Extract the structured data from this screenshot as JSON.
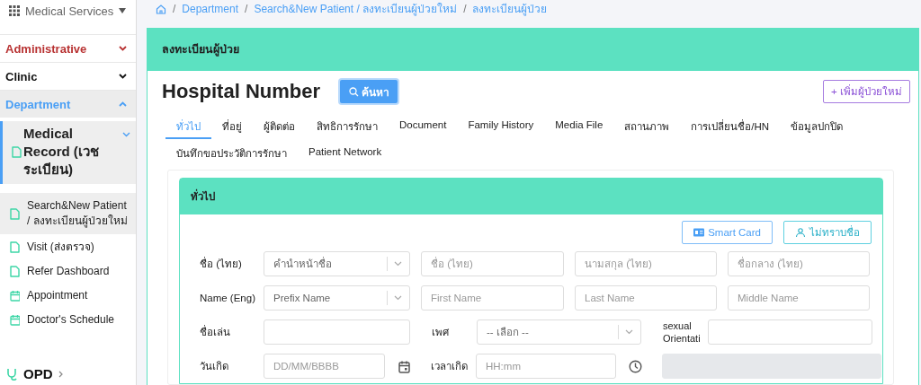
{
  "sidebar": {
    "header": "Medical Services",
    "sections": [
      {
        "kind": "group",
        "label": "Administrative",
        "color": "#b83232",
        "expanded": false
      },
      {
        "kind": "group",
        "label": "Clinic",
        "color": "#111111",
        "expanded": false
      },
      {
        "kind": "group",
        "label": "Department",
        "color": "#4a9ff5",
        "expanded": true,
        "children": [
          {
            "label": "Medical Record (เวชระเบียน)",
            "kind": "file",
            "expanded": true,
            "active": true,
            "children": [
              {
                "label": "Search&New Patient / ลงทะเบียนผู้ป่วยใหม่",
                "kind": "file",
                "selected": true
              },
              {
                "label": "Visit (ส่งตรวจ)",
                "kind": "file",
                "selected": false
              },
              {
                "label": "Refer Dashboard",
                "kind": "file",
                "selected": false
              },
              {
                "label": "Appointment",
                "kind": "calendar",
                "selected": false
              },
              {
                "label": "Doctor's Schedule",
                "kind": "calendar",
                "selected": false
              }
            ]
          }
        ]
      },
      {
        "kind": "module",
        "label": "OPD",
        "color": "#111111",
        "expanded": false
      }
    ]
  },
  "breadcrumb": {
    "separator": "/",
    "items": [
      "Department",
      "Search&New Patient / ลงทะเบียนผู้ป่วยใหม่",
      "ลงทะเบียนผู้ป่วย"
    ]
  },
  "card": {
    "title": "ลงทะเบียนผู้ป่วย",
    "heading": "Hospital Number",
    "search_button": "ค้นหา",
    "add_button": "+ เพิ่มผู้ป่วยใหม่",
    "tabs": [
      {
        "label": "ทั่วไป",
        "selected": true
      },
      {
        "label": "ที่อยู่",
        "selected": false
      },
      {
        "label": "ผู้ติดต่อ",
        "selected": false
      },
      {
        "label": "สิทธิการรักษา",
        "selected": false
      },
      {
        "label": "Document",
        "selected": false
      },
      {
        "label": "Family History",
        "selected": false
      },
      {
        "label": "Media File",
        "selected": false
      },
      {
        "label": "สถานภาพ",
        "selected": false
      },
      {
        "label": "การเปลี่ยนชื่อ/HN",
        "selected": false
      },
      {
        "label": "ข้อมูลปกปิด",
        "selected": false
      },
      {
        "label": "บันทึกขอประวัติการรักษา",
        "selected": false
      },
      {
        "label": "Patient Network",
        "selected": false
      }
    ],
    "section": {
      "title": "ทั่วไป",
      "buttons": [
        {
          "kind": "card",
          "label": "Smart Card"
        },
        {
          "kind": "person",
          "label": "ไม่ทราบชื่อ"
        }
      ],
      "rows": [
        [
          {
            "kind": "label",
            "text": "ชื่อ (ไทย)"
          },
          {
            "kind": "select",
            "placeholder": "คำนำหน้าชื่อ"
          },
          {
            "kind": "input",
            "placeholder": "ชื่อ (ไทย)"
          },
          {
            "kind": "input",
            "placeholder": "นามสกุล (ไทย)"
          },
          {
            "kind": "input",
            "placeholder": "ชื่อกลาง (ไทย)"
          }
        ],
        [
          {
            "kind": "label",
            "text": "Name (Eng)"
          },
          {
            "kind": "select",
            "placeholder": "Prefix Name"
          },
          {
            "kind": "input",
            "placeholder": "First Name"
          },
          {
            "kind": "input",
            "placeholder": "Last Name"
          },
          {
            "kind": "input",
            "placeholder": "Middle Name"
          }
        ],
        [
          {
            "kind": "label",
            "text": "ชื่อเล่น"
          },
          {
            "kind": "input"
          },
          {
            "kind": "label",
            "text": "เพศ"
          },
          {
            "kind": "select",
            "placeholder": "-- เลือก --"
          },
          {
            "kind": "label",
            "text": "sexual Orientati"
          },
          {
            "kind": "input"
          }
        ],
        [
          {
            "kind": "label",
            "text": "วันเกิด"
          },
          {
            "kind": "date",
            "placeholder": "DD/MM/BBBB"
          },
          {
            "kind": "label",
            "text": "เวลาเกิด"
          },
          {
            "kind": "time",
            "placeholder": "HH:mm"
          },
          {
            "kind": "readonly"
          }
        ]
      ]
    }
  }
}
